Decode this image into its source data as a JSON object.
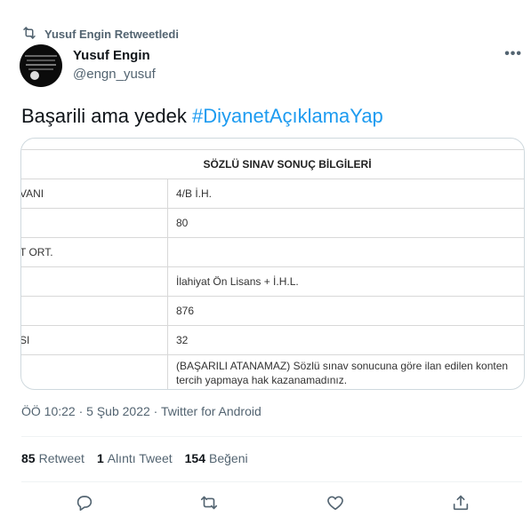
{
  "retweet_header": {
    "text": "Yusuf Engin Retweetledi"
  },
  "author": {
    "name": "Yusuf Engin",
    "handle": "@engn_yusuf"
  },
  "tweet": {
    "text_plain": "Başarili ama yedek ",
    "hashtag": "#DiyanetAçıklamaYap"
  },
  "media": {
    "title": "SÖZLÜ SINAV SONUÇ BİLGİLERİ",
    "rows": [
      {
        "label": "VANI",
        "value": "4/B İ.H."
      },
      {
        "label": "",
        "value": "80"
      },
      {
        "label": "T ORT.",
        "value": ""
      },
      {
        "label": "",
        "value": "İlahiyat Ön Lisans + İ.H.L."
      },
      {
        "label": "",
        "value": "876"
      },
      {
        "label": "SI",
        "value": "32"
      },
      {
        "label": "",
        "value": "(BAŞARILI ATANAMAZ) Sözlü sınav sonucuna göre ilan edilen konten",
        "value2": "tercih yapmaya hak kazanamadınız."
      }
    ]
  },
  "meta": {
    "text": "ÖÖ 10:22 · 5 Şub 2022 · Twitter for Android"
  },
  "stats": {
    "retweets_count": "85",
    "retweets_label": "Retweet",
    "quotes_count": "1",
    "quotes_label": "Alıntı Tweet",
    "likes_count": "154",
    "likes_label": "Beğeni"
  },
  "icons": [
    "retweet-icon",
    "more-icon",
    "reply-icon",
    "like-icon",
    "share-icon"
  ],
  "colors": {
    "accent": "#1d9bf0",
    "secondary_text": "#536471"
  }
}
